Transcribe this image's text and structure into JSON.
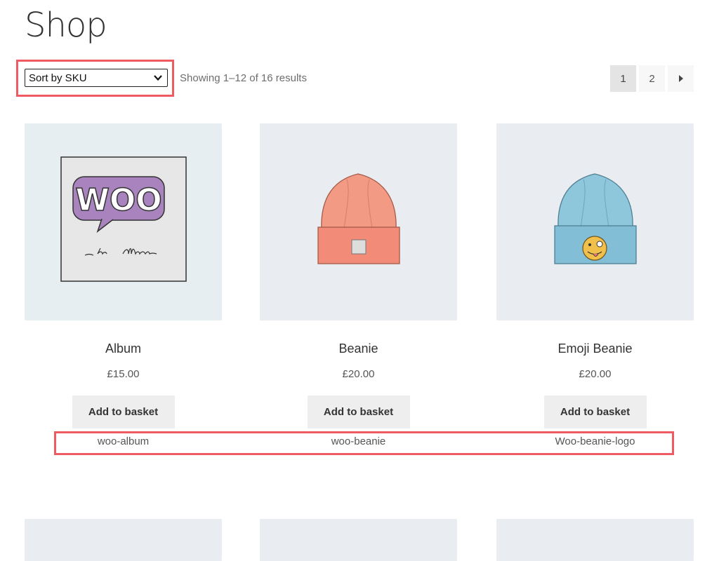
{
  "page": {
    "title": "Shop"
  },
  "toolbar": {
    "sort_label": "Sort by SKU",
    "result_count": "Showing 1–12 of 16 results"
  },
  "pagination": {
    "pages": [
      "1",
      "2"
    ],
    "current": "1",
    "next_icon": "caret-right-icon"
  },
  "products": [
    {
      "title": "Album",
      "price": "£15.00",
      "button": "Add to basket",
      "sku": "woo-album",
      "image_icon": "album-cover-icon"
    },
    {
      "title": "Beanie",
      "price": "£20.00",
      "button": "Add to basket",
      "sku": "woo-beanie",
      "image_icon": "beanie-icon"
    },
    {
      "title": "Emoji Beanie",
      "price": "£20.00",
      "button": "Add to basket",
      "sku": "Woo-beanie-logo",
      "image_icon": "emoji-beanie-icon"
    }
  ],
  "colors": {
    "highlight": "#ef5b62",
    "thumb_bg": "#e9ecf1",
    "button_bg": "#eeeeee"
  }
}
